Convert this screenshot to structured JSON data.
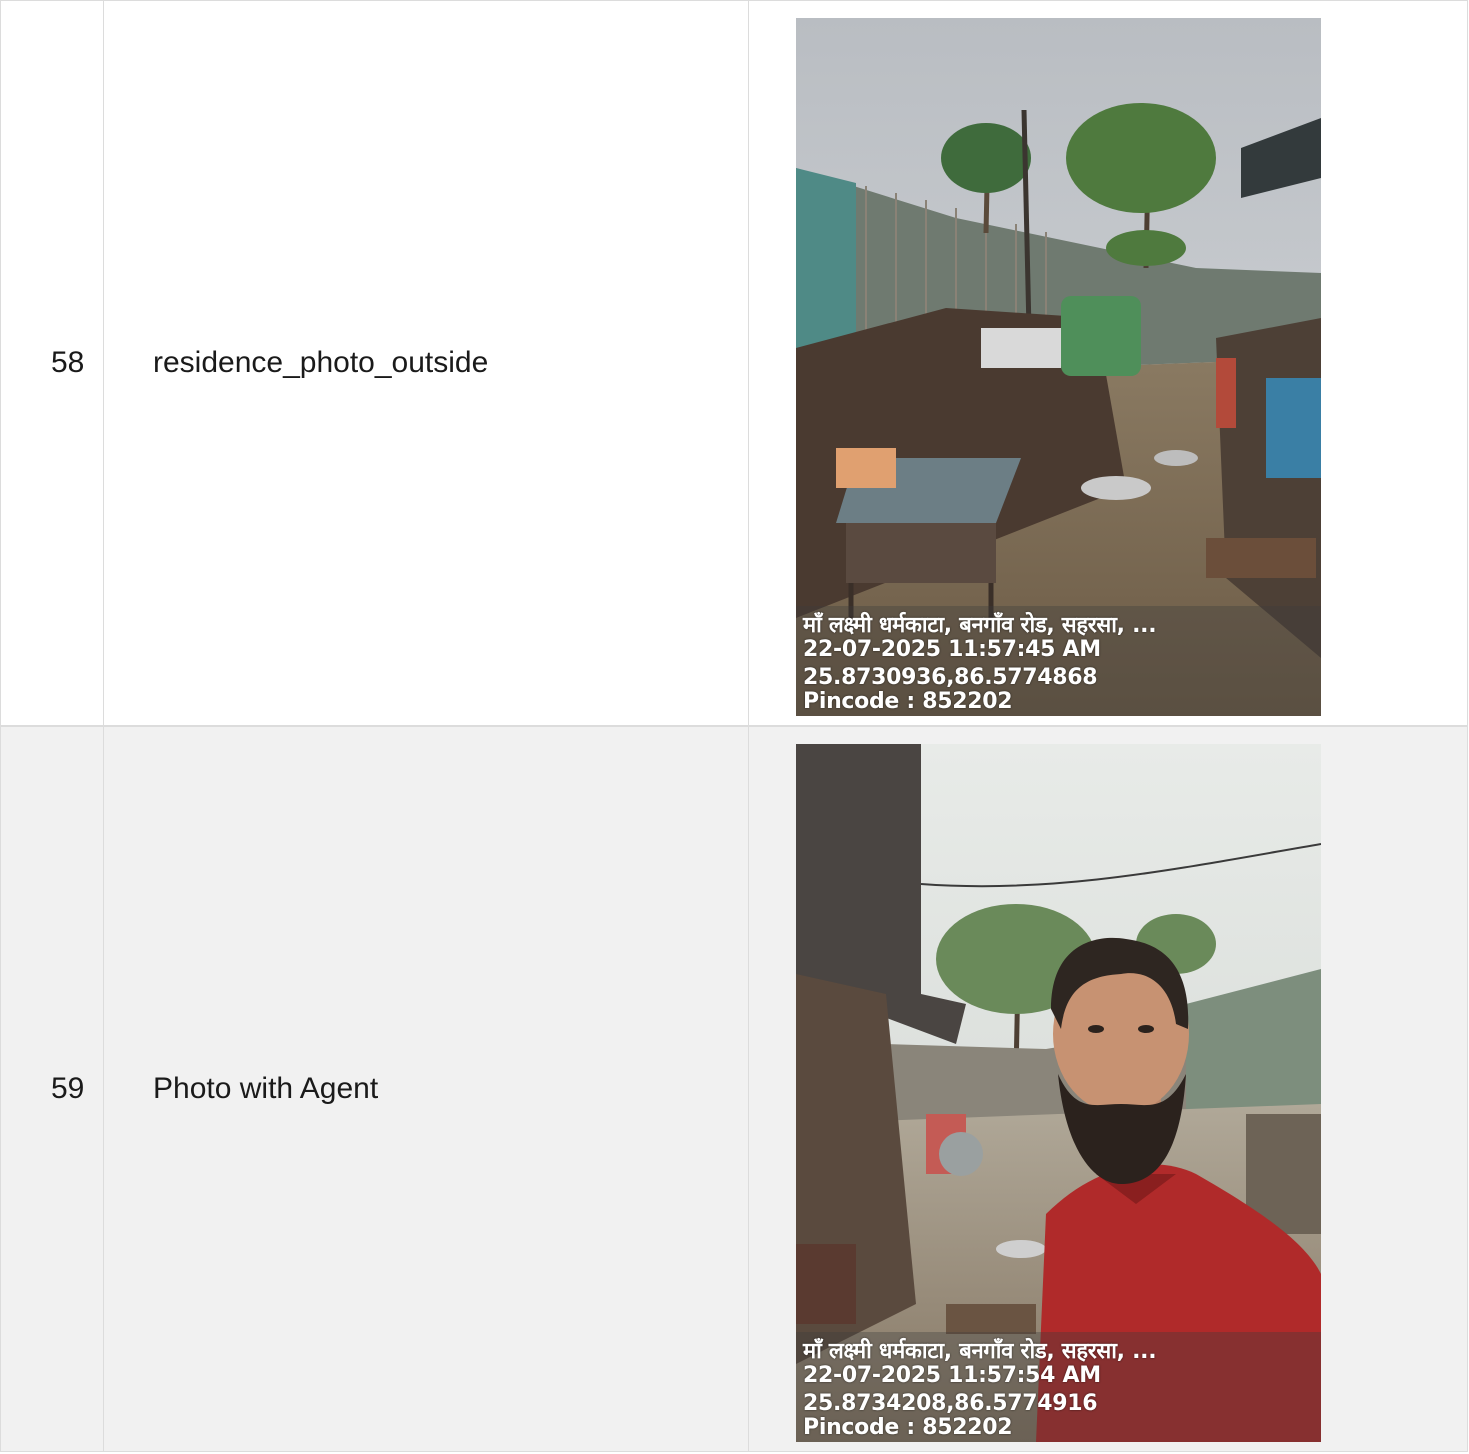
{
  "rows": [
    {
      "number": "58",
      "label": "residence_photo_outside",
      "photo": {
        "subject": "scrap yard with corrugated fence, palm tree, vehicles and scrap piles",
        "stamp_lines": [
          "माँ लक्ष्मी धर्मकाटा, बनगाँव रोड, सहरसा, ...",
          "22-07-2025 11:57:45 AM",
          "25.8730936,86.5774868",
          "Pincode : 852202"
        ]
      }
    },
    {
      "number": "59",
      "label": "Photo with Agent",
      "photo": {
        "subject": "selfie of bearded man in red shirt in scrap yard",
        "stamp_lines": [
          "माँ लक्ष्मी धर्मकाटा, बनगाँव रोड, सहरसा, ...",
          "22-07-2025 11:57:54 AM",
          "25.8734208,86.5774916",
          "Pincode : 852202"
        ]
      }
    }
  ],
  "colors": {
    "row_alt_background": "#f1f1f1",
    "border": "#dcdcdc",
    "text": "#1a1a1a"
  }
}
